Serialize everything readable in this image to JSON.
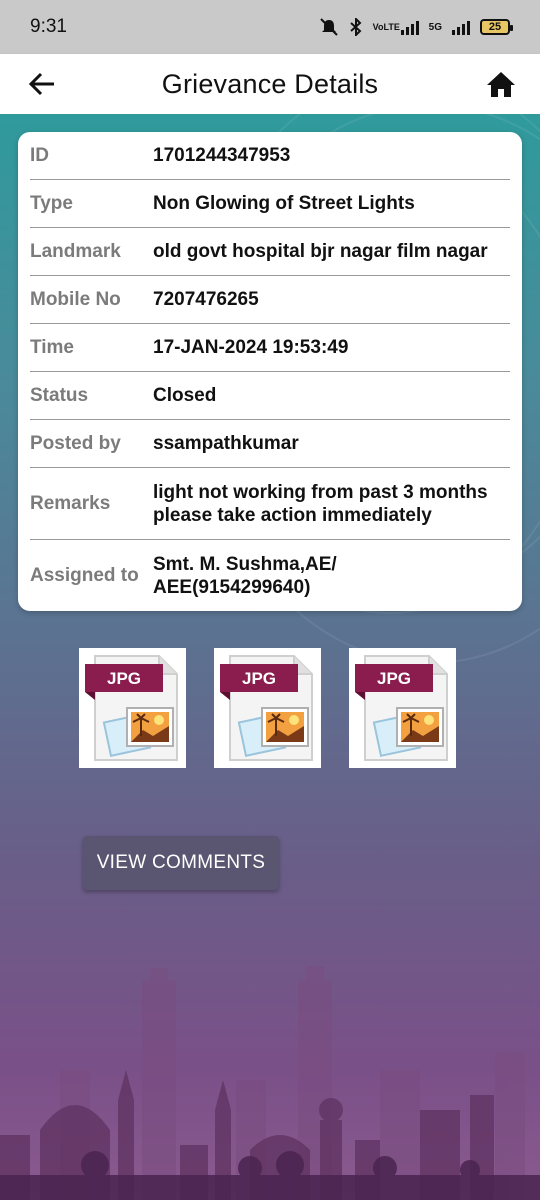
{
  "status_bar": {
    "time": "9:31",
    "network_label": "VoLTE",
    "network_5g": "5G",
    "battery": "25"
  },
  "header": {
    "title": "Grievance Details",
    "back_icon": "arrow-left-icon",
    "home_icon": "home-icon"
  },
  "details": {
    "rows": [
      {
        "label": "ID",
        "value": "1701244347953"
      },
      {
        "label": "Type",
        "value": "Non Glowing of Street Lights"
      },
      {
        "label": "Landmark",
        "value": "old govt hospital bjr nagar film nagar"
      },
      {
        "label": "Mobile No",
        "value": "7207476265"
      },
      {
        "label": "Time",
        "value": "17-JAN-2024 19:53:49"
      },
      {
        "label": "Status",
        "value": "Closed"
      },
      {
        "label": "Posted by",
        "value": "ssampathkumar"
      },
      {
        "label": "Remarks",
        "value": "light not working from past 3 months please take action immediately"
      },
      {
        "label": "Assigned to",
        "value": "Smt. M. Sushma,AE/ AEE(9154299640)"
      }
    ]
  },
  "attachments": [
    {
      "type_label": "JPG"
    },
    {
      "type_label": "JPG"
    },
    {
      "type_label": "JPG"
    }
  ],
  "actions": {
    "view_comments": "VIEW COMMENTS"
  },
  "colors": {
    "header_bg": "#ffffff",
    "status_bar_bg": "#c9c9c9",
    "label_color": "#7b7b7b",
    "button_bg": "#5a5570",
    "jpg_badge": "#8a1c4e"
  }
}
